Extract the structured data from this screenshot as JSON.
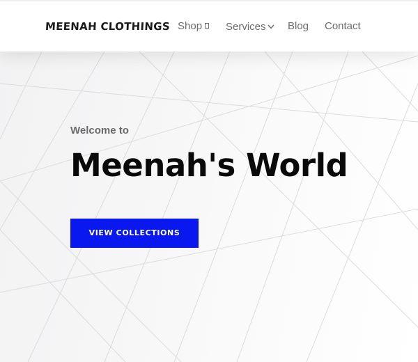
{
  "header": {
    "logo_text": "MEENAH CLOTHINGS",
    "nav": {
      "shop": "Shop",
      "services": "Services",
      "blog": "Blog",
      "contact": "Contact"
    }
  },
  "hero": {
    "eyebrow": "Welcome to",
    "title": "Meenah's World",
    "cta_label": "VIEW COLLECTIONS"
  },
  "colors": {
    "accent": "#0818ee",
    "title": "#0a0a0a",
    "nav_text": "#6b6b6b"
  },
  "icons": {
    "shop_dropdown": "dropdown-box-icon",
    "services_dropdown": "chevron-down-icon"
  }
}
